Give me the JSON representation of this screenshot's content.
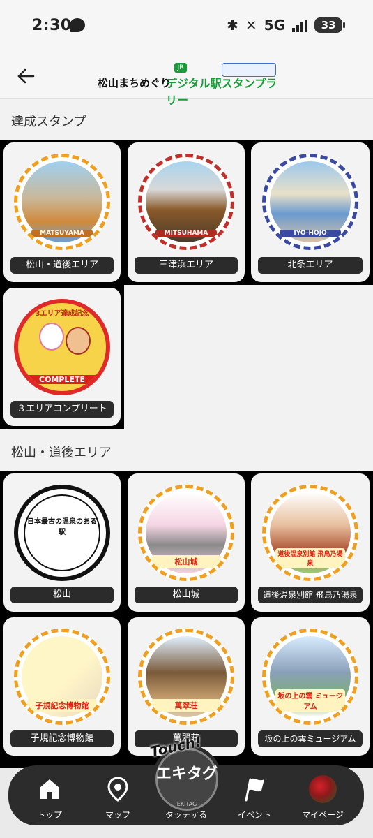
{
  "status": {
    "time": "2:30",
    "network": "5G",
    "battery": "33"
  },
  "header": {
    "title_left": "松山まちめぐり",
    "title_right": "デジタル駅スタンプラリー",
    "badge": "JR"
  },
  "sections": {
    "achieved": {
      "title": "達成スタンプ"
    },
    "matsuyama": {
      "title": "松山・道後エリア"
    }
  },
  "achieved_cards": [
    {
      "label": "松山・道後エリア",
      "stamp_text": "MATSUYAMA"
    },
    {
      "label": "三津浜エリア",
      "stamp_text": "MITSUHAMA"
    },
    {
      "label": "北条エリア",
      "stamp_text": "IYO-HOJO"
    },
    {
      "label": "３エリアコンプリート",
      "stamp_text": "COMPLETE",
      "stamp_top": "3エリア達成記念"
    }
  ],
  "area_cards": [
    {
      "label": "松山",
      "stamp_text": "日本最古の温泉のある駅"
    },
    {
      "label": "松山城",
      "stamp_text": "松山城"
    },
    {
      "label": "道後温泉別館 飛鳥乃湯泉",
      "stamp_text": "道後温泉別館 飛鳥乃湯泉"
    },
    {
      "label": "子規記念博物館",
      "stamp_text": "子規記念博物館"
    },
    {
      "label": "萬翠荘",
      "stamp_text": "萬翠荘"
    },
    {
      "label": "坂の上の雲ミュージアム",
      "stamp_text": "坂の上の雲 ミュージアム"
    }
  ],
  "nav": {
    "top": "トップ",
    "map": "マップ",
    "touch": "タッチする",
    "event": "イベント",
    "mypage": "マイページ",
    "touch_brand": "Touch!",
    "touch_logo": "エキタグ",
    "touch_sub": "EKITAG"
  },
  "colors": {
    "stamp_border": "#f0a020",
    "label_bg": "#2b2b2b",
    "grid_bg": "#000000",
    "nav_bg": "#2c2c2c"
  }
}
